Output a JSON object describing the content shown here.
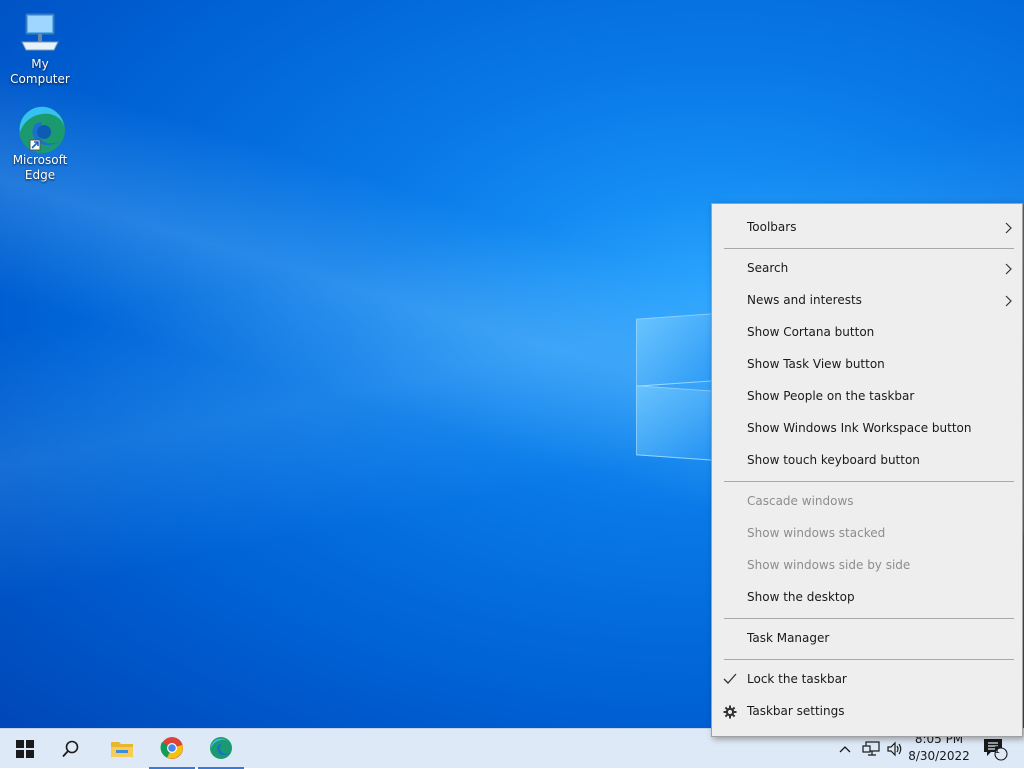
{
  "desktop": {
    "icons": [
      {
        "label": "My Computer",
        "icon": "computer-icon"
      },
      {
        "label": "Microsoft Edge",
        "icon": "edge-icon"
      }
    ]
  },
  "context_menu": {
    "items": [
      {
        "label": "Toolbars",
        "submenu": true,
        "enabled": true
      },
      {
        "label": "Search",
        "submenu": true,
        "enabled": true
      },
      {
        "label": "News and interests",
        "submenu": true,
        "enabled": true
      },
      {
        "label": "Show Cortana button",
        "enabled": true
      },
      {
        "label": "Show Task View button",
        "enabled": true
      },
      {
        "label": "Show People on the taskbar",
        "enabled": true
      },
      {
        "label": "Show Windows Ink Workspace button",
        "enabled": true
      },
      {
        "label": "Show touch keyboard button",
        "enabled": true
      },
      {
        "label": "Cascade windows",
        "enabled": false
      },
      {
        "label": "Show windows stacked",
        "enabled": false
      },
      {
        "label": "Show windows side by side",
        "enabled": false
      },
      {
        "label": "Show the desktop",
        "enabled": true
      },
      {
        "label": "Task Manager",
        "enabled": true
      },
      {
        "label": "Lock the taskbar",
        "checked": true,
        "enabled": true
      },
      {
        "label": "Taskbar settings",
        "icon": "gear-icon",
        "enabled": true
      }
    ]
  },
  "taskbar": {
    "pinned": [
      "start-icon",
      "search-icon",
      "file-explorer-icon",
      "chrome-icon",
      "edge-icon"
    ],
    "tray": {
      "time": "8:05 PM",
      "date": "8/30/2022",
      "notification_count": "1"
    }
  },
  "colors": {
    "accent": "#3a7bd5",
    "menu_bg": "#eeeeee",
    "taskbar_bg": "#dde9f6"
  }
}
